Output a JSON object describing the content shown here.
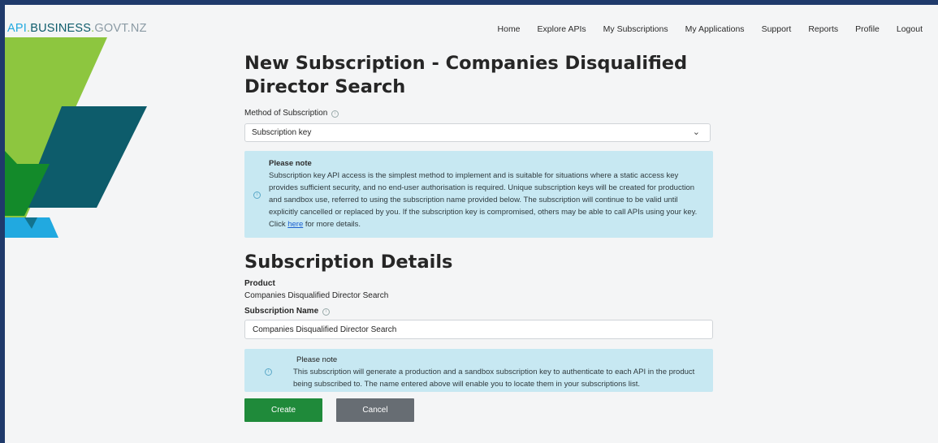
{
  "brand": {
    "api": "API",
    "dot1": ".",
    "business": "BUSINESS",
    "dot2": ".",
    "govt": "GOVT.NZ"
  },
  "nav": [
    "Home",
    "Explore APIs",
    "My Subscriptions",
    "My Applications",
    "Support",
    "Reports",
    "Profile",
    "Logout"
  ],
  "page": {
    "title": "New Subscription - Companies Disqualified Director Search"
  },
  "method": {
    "label": "Method of Subscription",
    "info_icon": "info-icon",
    "selected": "Subscription key",
    "chevron_icon": "chevron-down-icon"
  },
  "note1": {
    "title": "Please note",
    "text": "Subscription key API access is the simplest method to implement and is suitable for situations where a static access key provides sufficient security, and no end-user authorisation is required. Unique subscription keys will be created for production and sandbox use, referred to using the subscription name provided below. The subscription will continue to be valid until explicitly cancelled or replaced by you. If the subscription key is compromised, others may be able to call APIs using your key. Click ",
    "link": "here",
    "text_after": " for more details."
  },
  "details": {
    "heading": "Subscription Details",
    "product_label": "Product",
    "product_value": "Companies Disqualified Director Search",
    "name_label": "Subscription Name",
    "name_value": "Companies Disqualified Director Search"
  },
  "note2": {
    "title": "Please note",
    "text": "This subscription will generate a production and a sandbox subscription key to authenticate to each API in the product being subscribed to. The name entered above will enable you to locate them in your subscriptions list."
  },
  "actions": {
    "create": "Create",
    "cancel": "Cancel"
  },
  "colors": {
    "frame_border": "#1f3a6b",
    "lime": "#8dc63f",
    "teal": "#0d5c6b",
    "sky": "#21a9e0",
    "green_button": "#1f8a3a",
    "grey_button": "#676d73",
    "note_background": "#c7e8f2"
  }
}
